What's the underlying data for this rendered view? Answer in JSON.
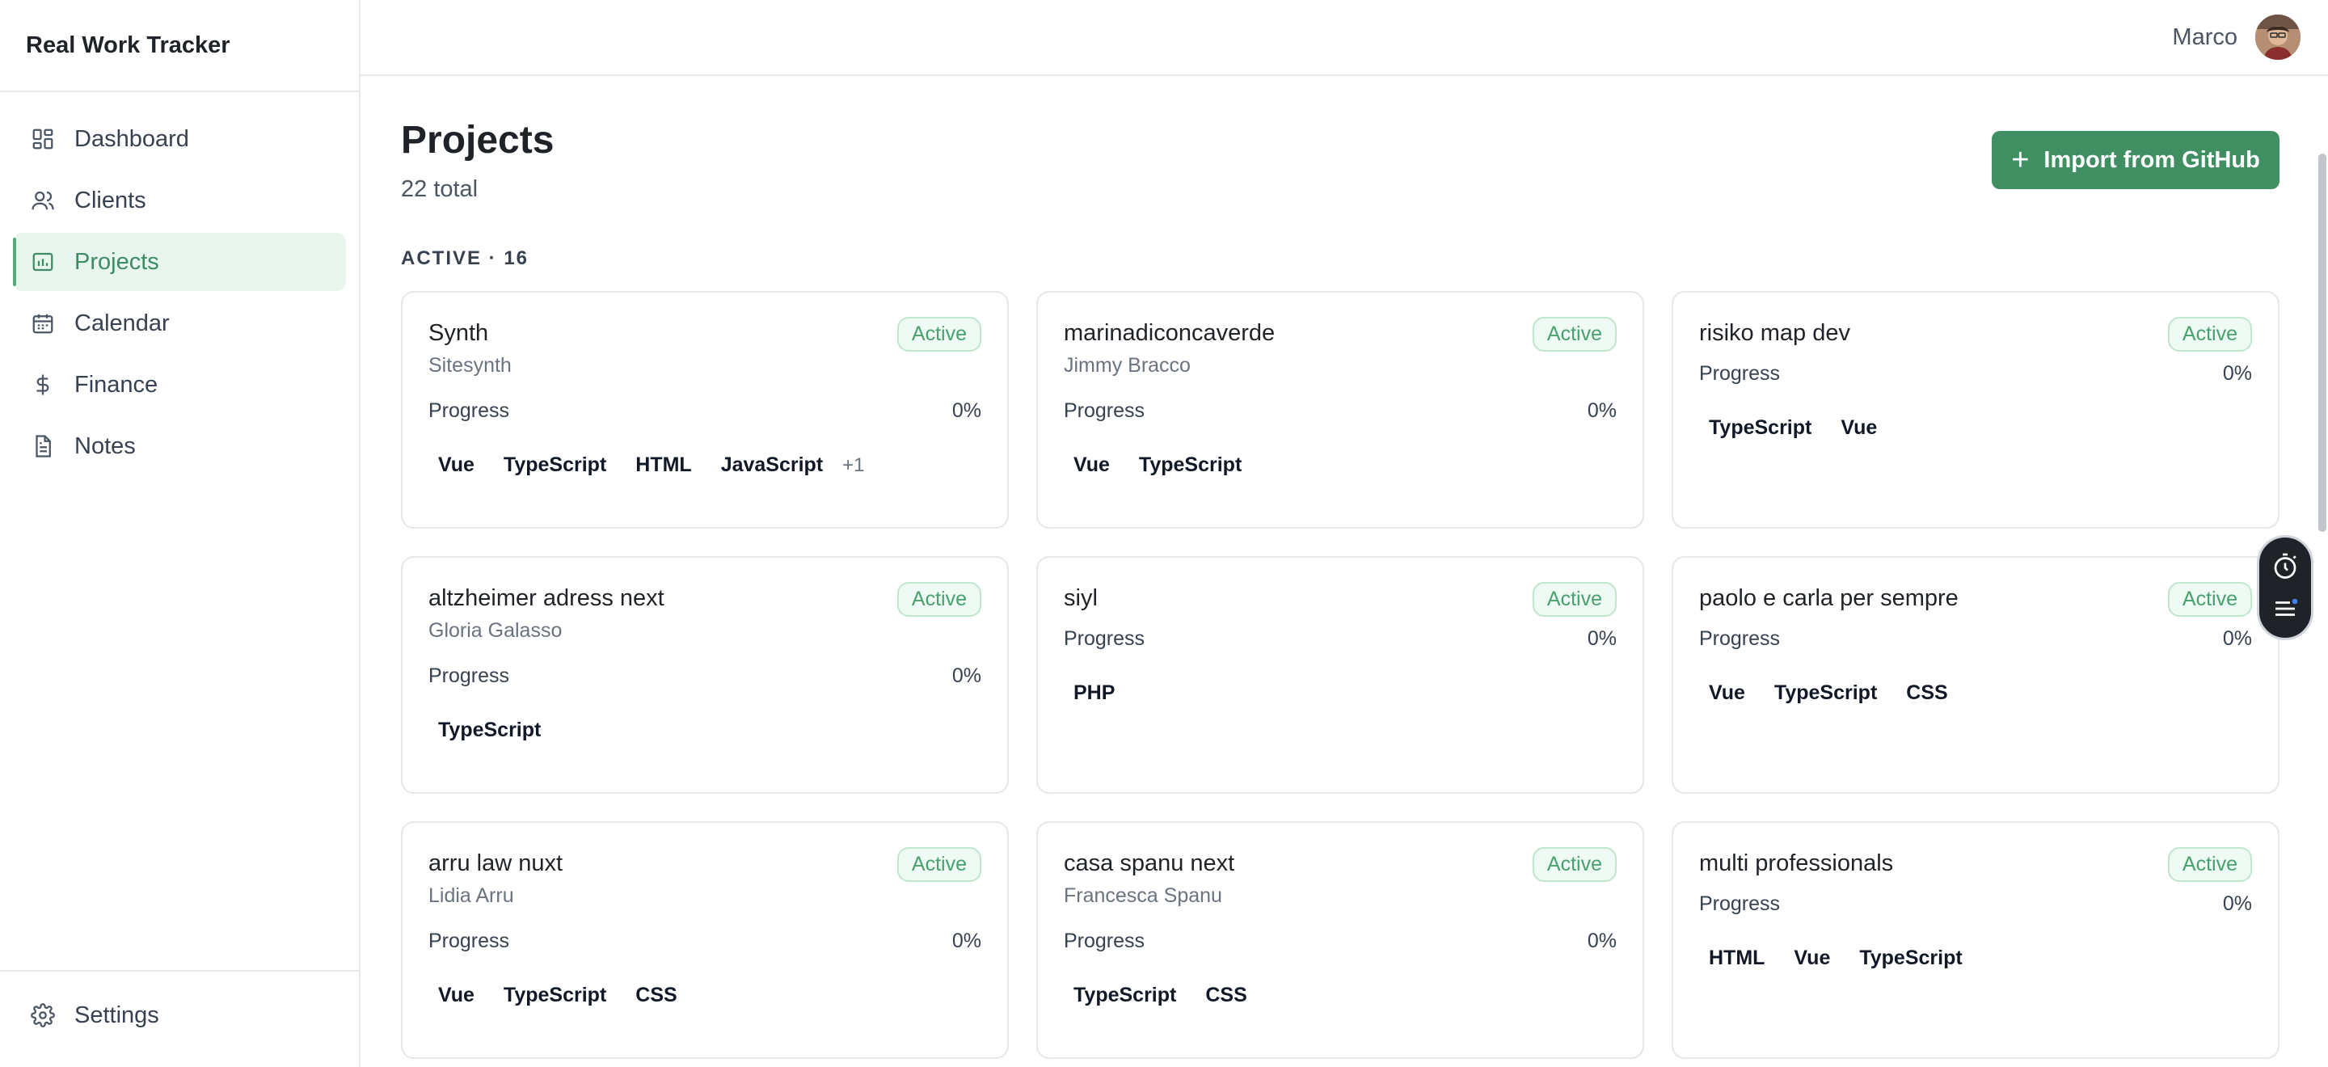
{
  "app": {
    "title": "Real Work Tracker"
  },
  "sidebar": {
    "items": [
      {
        "label": "Dashboard",
        "icon": "dashboard-icon"
      },
      {
        "label": "Clients",
        "icon": "users-icon"
      },
      {
        "label": "Projects",
        "icon": "projects-icon",
        "active": true
      },
      {
        "label": "Calendar",
        "icon": "calendar-icon"
      },
      {
        "label": "Finance",
        "icon": "dollar-icon"
      },
      {
        "label": "Notes",
        "icon": "notes-icon"
      }
    ],
    "settings_label": "Settings"
  },
  "topbar": {
    "username": "Marco"
  },
  "page": {
    "title": "Projects",
    "subtitle": "22 total",
    "import_button": "Import from GitHub",
    "section_label": "ACTIVE · 16"
  },
  "projects": [
    {
      "name": "Synth",
      "status": "Active",
      "client": "Sitesynth",
      "progress_label": "Progress",
      "progress": "0%",
      "tags": [
        "Vue",
        "TypeScript",
        "HTML",
        "JavaScript"
      ],
      "more": "+1"
    },
    {
      "name": "marinadiconcaverde",
      "status": "Active",
      "client": "Jimmy Bracco",
      "progress_label": "Progress",
      "progress": "0%",
      "tags": [
        "Vue",
        "TypeScript"
      ],
      "more": ""
    },
    {
      "name": "risiko map dev",
      "status": "Active",
      "client": "",
      "progress_label": "Progress",
      "progress": "0%",
      "tags": [
        "TypeScript",
        "Vue"
      ],
      "more": ""
    },
    {
      "name": "altzheimer adress next",
      "status": "Active",
      "client": "Gloria Galasso",
      "progress_label": "Progress",
      "progress": "0%",
      "tags": [
        "TypeScript"
      ],
      "more": ""
    },
    {
      "name": "siyl",
      "status": "Active",
      "client": "",
      "progress_label": "Progress",
      "progress": "0%",
      "tags": [
        "PHP"
      ],
      "more": ""
    },
    {
      "name": "paolo e carla per sempre",
      "status": "Active",
      "client": "",
      "progress_label": "Progress",
      "progress": "0%",
      "tags": [
        "Vue",
        "TypeScript",
        "CSS"
      ],
      "more": ""
    },
    {
      "name": "arru law nuxt",
      "status": "Active",
      "client": "Lidia Arru",
      "progress_label": "Progress",
      "progress": "0%",
      "tags": [
        "Vue",
        "TypeScript",
        "CSS"
      ],
      "more": ""
    },
    {
      "name": "casa spanu next",
      "status": "Active",
      "client": "Francesca Spanu",
      "progress_label": "Progress",
      "progress": "0%",
      "tags": [
        "TypeScript",
        "CSS"
      ],
      "more": ""
    },
    {
      "name": "multi professionals",
      "status": "Active",
      "client": "",
      "progress_label": "Progress",
      "progress": "0%",
      "tags": [
        "HTML",
        "Vue",
        "TypeScript"
      ],
      "more": ""
    }
  ],
  "colors": {
    "accent": "#3f8f63",
    "active_nav_bg": "#e8f6ee",
    "badge_text": "#47a26f"
  },
  "float_widget": {
    "icons": [
      "timer-icon",
      "menu-notification-icon"
    ]
  }
}
